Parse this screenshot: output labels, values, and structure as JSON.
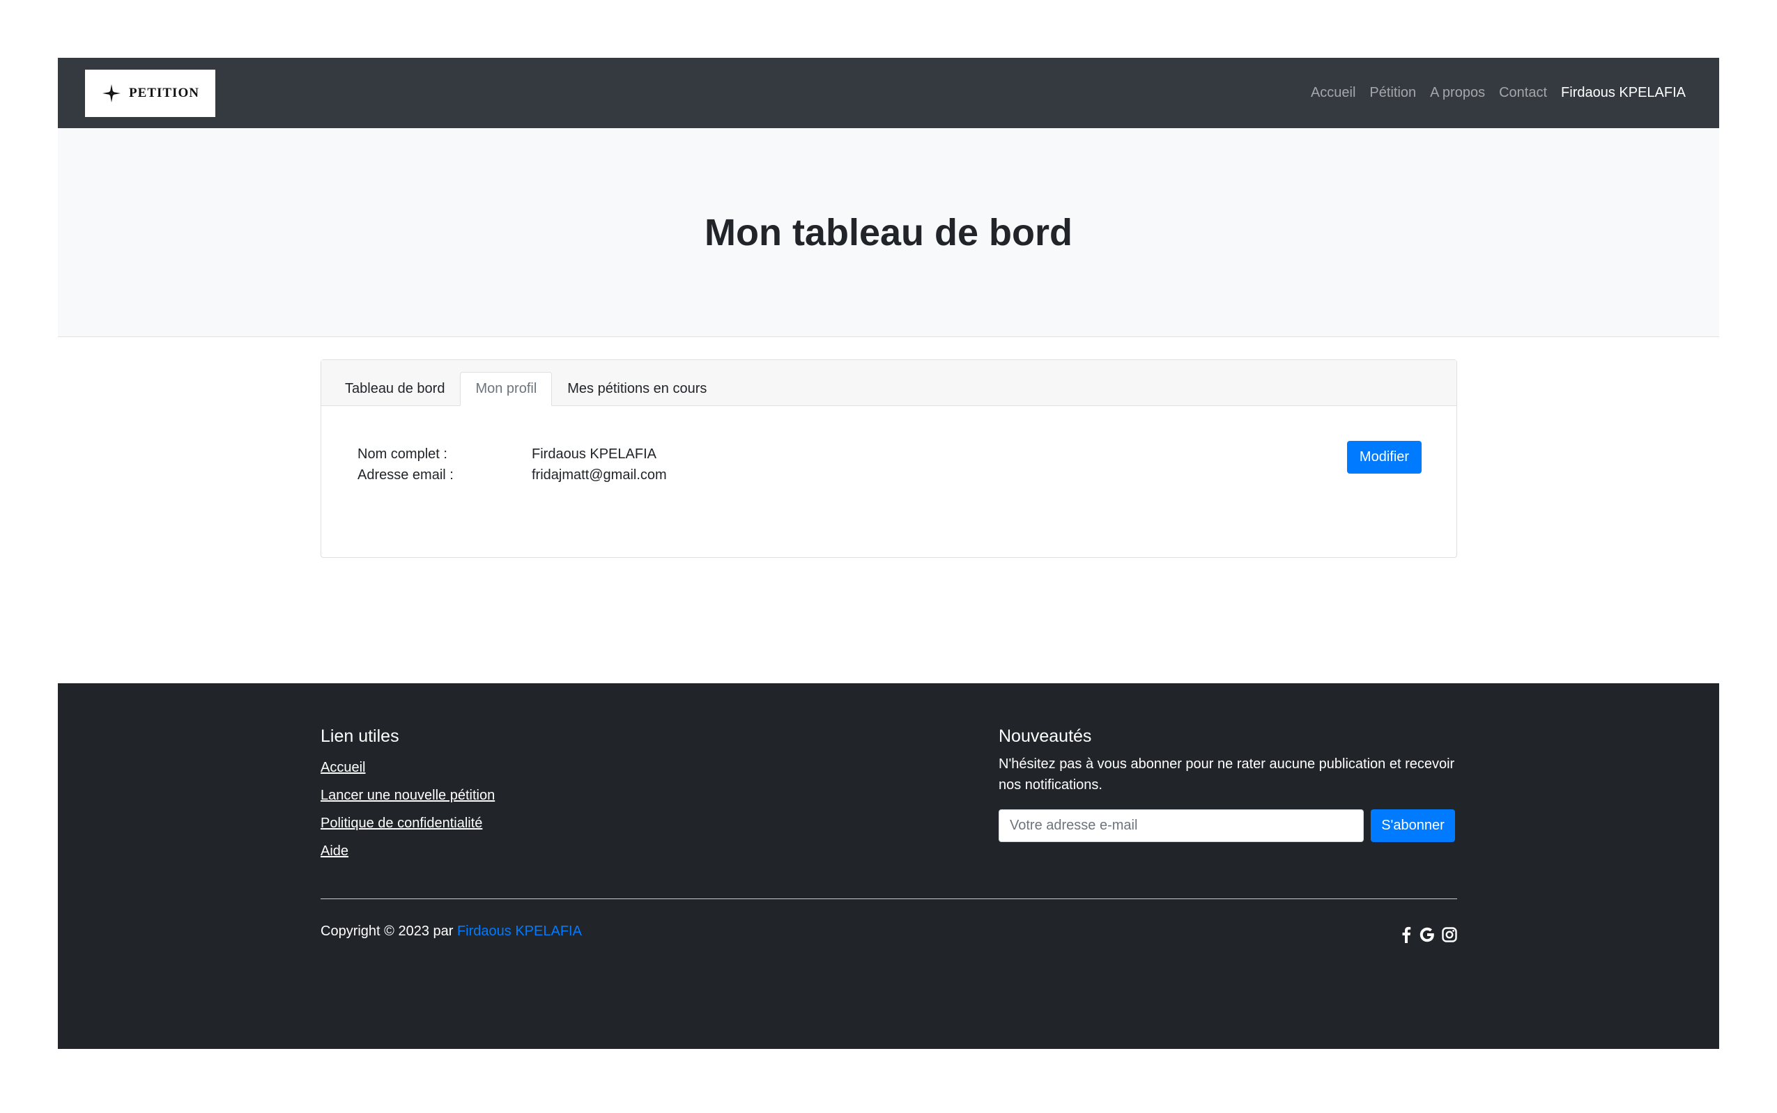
{
  "brand": {
    "name": "PETITION"
  },
  "nav": {
    "items": [
      {
        "label": "Accueil"
      },
      {
        "label": "Pétition"
      },
      {
        "label": "A propos"
      },
      {
        "label": "Contact"
      }
    ],
    "user": "Firdaous KPELAFIA"
  },
  "hero": {
    "title": "Mon tableau de bord"
  },
  "tabs": [
    {
      "label": "Tableau de bord",
      "active": false
    },
    {
      "label": "Mon profil",
      "active": true
    },
    {
      "label": "Mes pétitions en cours",
      "active": false
    }
  ],
  "profile": {
    "name_label": "Nom complet :",
    "name_value": "Firdaous KPELAFIA",
    "email_label": "Adresse email :",
    "email_value": "fridajmatt@gmail.com",
    "edit_label": "Modifier"
  },
  "footer": {
    "links_title": "Lien utiles",
    "links": [
      {
        "label": "Accueil"
      },
      {
        "label": "Lancer une nouvelle pétition"
      },
      {
        "label": "Politique de confidentialité"
      },
      {
        "label": "Aide"
      }
    ],
    "news_title": "Nouveautés",
    "news_text": "N'hésitez pas à vous abonner pour ne rater aucune publication et recevoir nos notifications.",
    "email_placeholder": "Votre adresse e-mail",
    "subscribe_label": "S'abonner",
    "copyright_prefix": "Copyright © 2023 par",
    "copyright_author": "Firdaous KPELAFIA",
    "social_icons": [
      "facebook-icon",
      "google-icon",
      "instagram-icon"
    ]
  },
  "colors": {
    "navbar": "#343a40",
    "footer": "#212529",
    "primary": "#007bff",
    "hero": "#f8f9fa"
  }
}
